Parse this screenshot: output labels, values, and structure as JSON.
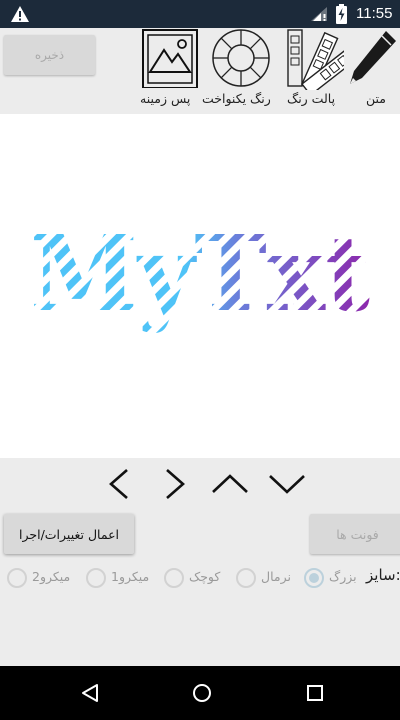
{
  "status_bar": {
    "time": "11:55",
    "icons": [
      "warning-icon",
      "signal-icon",
      "battery-charging-icon"
    ]
  },
  "toolbar": {
    "save_label": "ذخیره",
    "tools": [
      {
        "label": "متن",
        "icon": "pencil-icon"
      },
      {
        "label": "پالت رنگ",
        "icon": "palette-icon"
      },
      {
        "label": "رنگ یکنواخت",
        "icon": "color-wheel-icon"
      },
      {
        "label": "پس زمینه",
        "icon": "image-icon"
      }
    ]
  },
  "canvas": {
    "preview_text": "MyTxt",
    "colors": [
      "#4fc3f7",
      "#6a7fdb",
      "#8e24aa"
    ]
  },
  "arrows": [
    "chevron-left-icon",
    "chevron-right-icon",
    "chevron-up-icon",
    "chevron-down-icon"
  ],
  "actions": {
    "apply_label": "اعمال تغییرات/اجرا",
    "fonts_label": "فونت ها"
  },
  "size": {
    "label": "سایز:",
    "options": [
      {
        "label": "بزرگ",
        "checked": true
      },
      {
        "label": "نرمال",
        "checked": false
      },
      {
        "label": "کوچک",
        "checked": false
      },
      {
        "label": "میکرو1",
        "checked": false
      },
      {
        "label": "میکرو2",
        "checked": false
      }
    ]
  },
  "nav_bar": [
    "back-icon",
    "home-icon",
    "recents-icon"
  ]
}
